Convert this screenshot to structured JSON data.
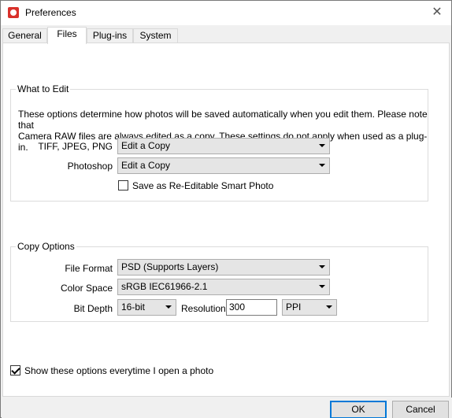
{
  "window": {
    "title": "Preferences",
    "close_glyph": "✕"
  },
  "tabs": [
    {
      "label": "General"
    },
    {
      "label": "Files"
    },
    {
      "label": "Plug-ins"
    },
    {
      "label": "System"
    }
  ],
  "what_to_edit": {
    "title": "What to Edit",
    "description_line1": "These options determine how photos will be saved automatically when you edit them.  Please note that",
    "description_line2": "Camera RAW files are always edited as a copy.  These settings do not apply when used as a plug-in.",
    "tiff_label": "TIFF, JPEG, PNG",
    "tiff_value": "Edit a Copy",
    "photoshop_label": "Photoshop",
    "photoshop_value": "Edit a Copy",
    "smart_photo_label": "Save as Re-Editable Smart Photo",
    "smart_photo_checked": false
  },
  "copy_options": {
    "title": "Copy Options",
    "file_format_label": "File Format",
    "file_format_value": "PSD (Supports Layers)",
    "color_space_label": "Color Space",
    "color_space_value": "sRGB IEC61966-2.1",
    "bit_depth_label": "Bit Depth",
    "bit_depth_value": "16-bit",
    "resolution_label": "Resolution",
    "resolution_value": "300",
    "resolution_unit": "PPI"
  },
  "show_options": {
    "label": "Show these options everytime I open a photo",
    "checked": true
  },
  "buttons": {
    "ok": "OK",
    "cancel": "Cancel"
  },
  "colors": {
    "accent": "#0078d7",
    "panel": "#ffffff",
    "chrome": "#f0f0f0"
  }
}
